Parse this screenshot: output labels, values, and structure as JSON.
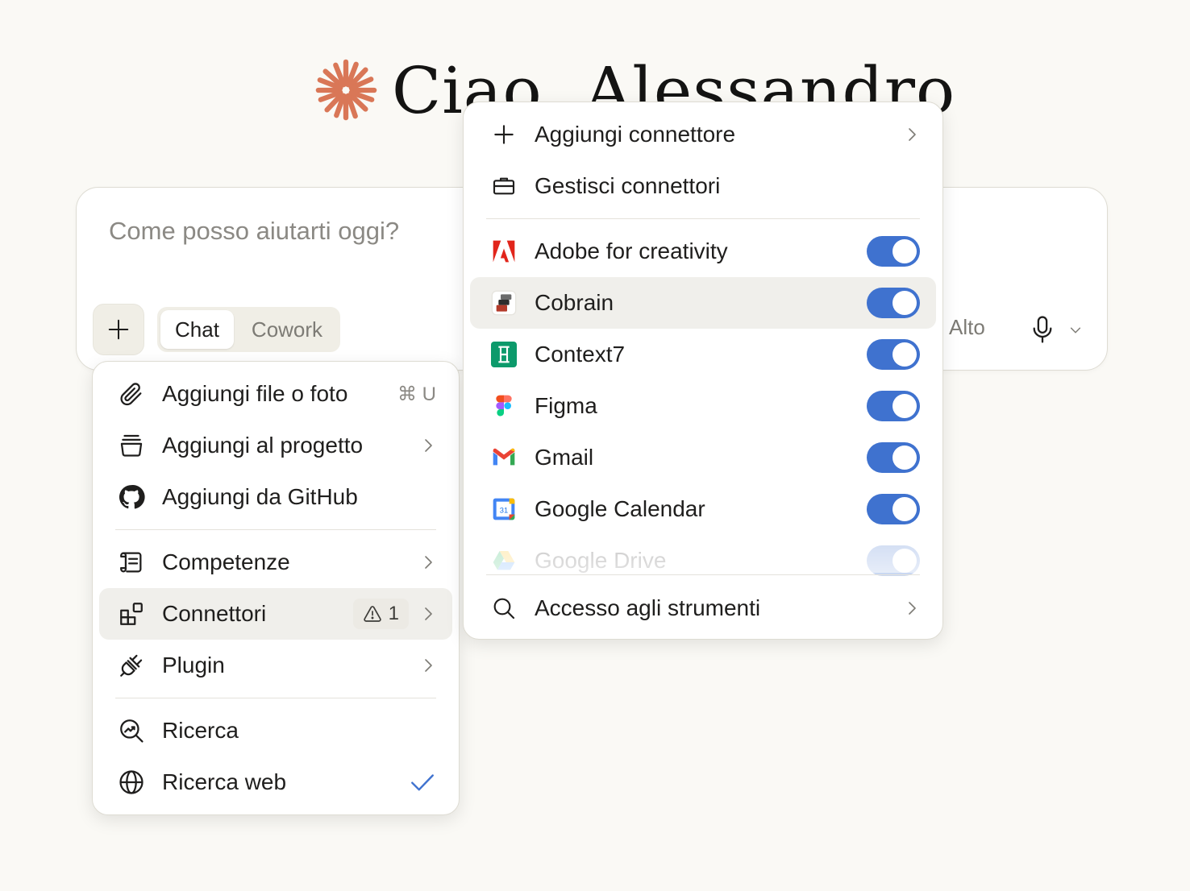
{
  "greeting": {
    "text": "Ciao, Alessandro",
    "logo_color": "#d97757"
  },
  "composer": {
    "placeholder": "Come posso aiutarti oggi?",
    "modes": [
      "Chat",
      "Cowork"
    ],
    "active_mode": "Chat",
    "effort_label": "Alto"
  },
  "add_menu": {
    "items": [
      {
        "label": "Aggiungi file o foto",
        "icon": "paperclip-icon",
        "shortcut": "⌘ U"
      },
      {
        "label": "Aggiungi al progetto",
        "icon": "project-icon",
        "submenu": true
      },
      {
        "label": "Aggiungi da GitHub",
        "icon": "github-icon"
      },
      {
        "label": "Competenze",
        "icon": "skills-icon",
        "submenu": true
      },
      {
        "label": "Connettori",
        "icon": "connectors-icon",
        "submenu": true,
        "badge": "1",
        "highlighted": true
      },
      {
        "label": "Plugin",
        "icon": "plug-icon",
        "submenu": true
      },
      {
        "label": "Ricerca",
        "icon": "research-icon"
      },
      {
        "label": "Ricerca web",
        "icon": "globe-icon",
        "checked": true
      }
    ]
  },
  "connectors_menu": {
    "add_label": "Aggiungi connettore",
    "manage_label": "Gestisci connettori",
    "connectors": [
      {
        "name": "Adobe for creativity",
        "icon": "adobe-icon",
        "enabled": true
      },
      {
        "name": "Cobrain",
        "icon": "cobrain-icon",
        "enabled": true,
        "highlighted": true
      },
      {
        "name": "Context7",
        "icon": "context7-icon",
        "enabled": true
      },
      {
        "name": "Figma",
        "icon": "figma-icon",
        "enabled": true
      },
      {
        "name": "Gmail",
        "icon": "gmail-icon",
        "enabled": true
      },
      {
        "name": "Google Calendar",
        "icon": "google-calendar-icon",
        "enabled": true,
        "calendar_day": "31"
      },
      {
        "name": "Google Drive",
        "icon": "google-drive-icon",
        "enabled": true
      }
    ],
    "tool_access_label": "Accesso agli strumenti"
  },
  "colors": {
    "accent": "#d97757",
    "toggle_on": "#3f72cf",
    "check": "#3f72cf"
  }
}
